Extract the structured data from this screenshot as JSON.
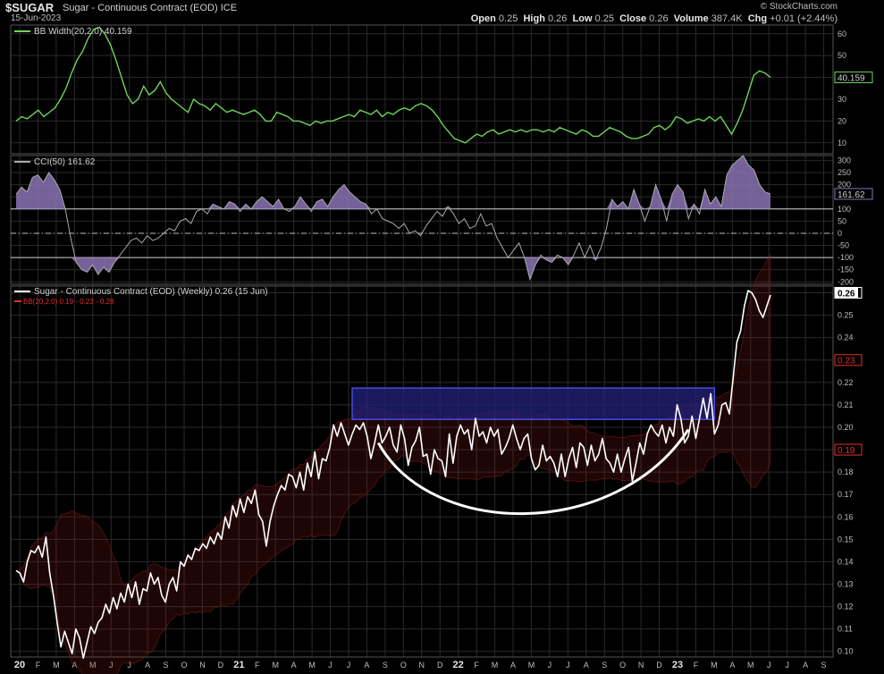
{
  "header": {
    "symbol": "$SUGAR",
    "description": "Sugar - Continuous Contract (EOD)",
    "exchange": "ICE",
    "date": "15-Jun-2023",
    "credit": "© StockCharts.com",
    "open_label": "Open",
    "open": "0.25",
    "high_label": "High",
    "high": "0.26",
    "low_label": "Low",
    "low": "0.25",
    "close_label": "Close",
    "close": "0.26",
    "volume_label": "Volume",
    "volume": "387.4K",
    "chg_label": "Chg",
    "chg": "+0.01 (+2.44%)"
  },
  "colors": {
    "background": "#000000",
    "grid": "#2a2a2a",
    "price_line": "#ffffff",
    "bb_width_line": "#6fd45a",
    "cci_line": "#aaaaaa",
    "cci_fill": "#8a73b3",
    "bb_band": "#8b1a1a",
    "rectangle_fill": "#23227a",
    "rectangle_stroke": "#4a4adf",
    "arc": "#ffffff",
    "label_red": "#e03030"
  },
  "chart_data": [
    {
      "type": "line",
      "panel": "bb-width",
      "legend": "BB Width(20,2.0) 40.159",
      "y_ticks": [
        10,
        20,
        30,
        40,
        50,
        60
      ],
      "ylim": [
        5,
        64
      ],
      "last_value_label": "40.159",
      "series": [
        {
          "name": "BB Width",
          "values": [
            20,
            22,
            21,
            23,
            25,
            22,
            24,
            26,
            30,
            35,
            42,
            48,
            52,
            58,
            62,
            63,
            60,
            55,
            48,
            40,
            32,
            28,
            30,
            36,
            32,
            34,
            38,
            33,
            30,
            28,
            26,
            24,
            30,
            28,
            27,
            25,
            28,
            26,
            24,
            25,
            24,
            23,
            24,
            25,
            23,
            20,
            20,
            24,
            23,
            22,
            20,
            20,
            19,
            18,
            20,
            19,
            20,
            20,
            21,
            22,
            23,
            22,
            25,
            24,
            23,
            25,
            22,
            24,
            23,
            25,
            26,
            25,
            27,
            28,
            27,
            25,
            22,
            18,
            15,
            12,
            11,
            10,
            12,
            14,
            13,
            15,
            16,
            14,
            15,
            16,
            15,
            16,
            15,
            16,
            16,
            15,
            16,
            15,
            17,
            16,
            15,
            14,
            16,
            15,
            13,
            13,
            15,
            17,
            16,
            15,
            13,
            12,
            12,
            13,
            14,
            17,
            18,
            16,
            18,
            22,
            21,
            19,
            20,
            21,
            20,
            22,
            20,
            22,
            18,
            14,
            19,
            25,
            33,
            41,
            43,
            42,
            40
          ]
        }
      ]
    },
    {
      "type": "line",
      "panel": "cci",
      "legend": "CCI(50) 161.62",
      "y_ticks": [
        -200,
        -150,
        -100,
        -50,
        0,
        50,
        100,
        150,
        200,
        250,
        300
      ],
      "ylim": [
        -210,
        320
      ],
      "reference_lines": [
        100,
        0,
        -100
      ],
      "last_value_label": "161.62",
      "series": [
        {
          "name": "CCI",
          "values": [
            160,
            190,
            170,
            230,
            240,
            210,
            250,
            220,
            180,
            100,
            -20,
            -120,
            -150,
            -160,
            -130,
            -170,
            -140,
            -160,
            -120,
            -90,
            -60,
            -30,
            -20,
            -40,
            -10,
            -30,
            -20,
            0,
            20,
            10,
            50,
            60,
            40,
            90,
            100,
            80,
            120,
            110,
            100,
            130,
            120,
            90,
            120,
            100,
            130,
            150,
            130,
            110,
            140,
            100,
            90,
            110,
            150,
            120,
            90,
            130,
            140,
            110,
            150,
            180,
            200,
            170,
            150,
            130,
            120,
            80,
            100,
            60,
            50,
            40,
            20,
            40,
            0,
            10,
            -10,
            30,
            60,
            90,
            70,
            110,
            80,
            40,
            60,
            20,
            30,
            80,
            30,
            40,
            -20,
            -60,
            -100,
            -70,
            -40,
            -100,
            -190,
            -130,
            -90,
            -110,
            -120,
            -90,
            -100,
            -130,
            -90,
            -40,
            -100,
            -50,
            -110,
            -60,
            20,
            140,
            110,
            130,
            100,
            180,
            120,
            50,
            110,
            200,
            140,
            50,
            160,
            200,
            170,
            60,
            120,
            80,
            180,
            120,
            150,
            110,
            240,
            280,
            300,
            320,
            280,
            260,
            200,
            170,
            162
          ]
        }
      ]
    },
    {
      "type": "line",
      "panel": "price",
      "legend": "Sugar - Continuous Contract (EOD) (Weekly) 0.26 (15 Jun)",
      "overlay_legend": "BB(20,2.0) 0.19 - 0.23 - 0.28",
      "y_ticks": [
        0.1,
        0.11,
        0.12,
        0.13,
        0.14,
        0.15,
        0.16,
        0.17,
        0.18,
        0.19,
        0.2,
        0.21,
        0.22,
        0.23,
        0.24,
        0.25,
        0.26
      ],
      "ylim": [
        0.0975,
        0.263
      ],
      "value_labels": {
        "last": "0.26",
        "upper_band": "0.23",
        "lower_band": "0.19"
      },
      "x_tick_labels": [
        "20",
        "F",
        "M",
        "A",
        "M",
        "J",
        "J",
        "A",
        "S",
        "O",
        "N",
        "D",
        "21",
        "F",
        "M",
        "A",
        "M",
        "J",
        "J",
        "A",
        "S",
        "O",
        "N",
        "D",
        "22",
        "F",
        "M",
        "A",
        "M",
        "J",
        "J",
        "A",
        "S",
        "O",
        "N",
        "D",
        "23",
        "F",
        "M",
        "A",
        "M",
        "J",
        "J",
        "A",
        "S"
      ],
      "series": [
        {
          "name": "Sugar",
          "values": [
            0.136,
            0.135,
            0.131,
            0.14,
            0.145,
            0.144,
            0.147,
            0.142,
            0.151,
            0.135,
            0.125,
            0.113,
            0.102,
            0.109,
            0.104,
            0.099,
            0.11,
            0.106,
            0.097,
            0.104,
            0.111,
            0.108,
            0.113,
            0.115,
            0.121,
            0.117,
            0.124,
            0.119,
            0.126,
            0.122,
            0.13,
            0.124,
            0.131,
            0.121,
            0.128,
            0.127,
            0.135,
            0.13,
            0.133,
            0.125,
            0.122,
            0.13,
            0.133,
            0.127,
            0.14,
            0.138,
            0.143,
            0.141,
            0.146,
            0.145,
            0.148,
            0.146,
            0.151,
            0.148,
            0.153,
            0.15,
            0.16,
            0.155,
            0.165,
            0.16,
            0.168,
            0.162,
            0.169,
            0.166,
            0.172,
            0.161,
            0.158,
            0.147,
            0.158,
            0.165,
            0.17,
            0.174,
            0.172,
            0.179,
            0.178,
            0.173,
            0.18,
            0.172,
            0.184,
            0.178,
            0.189,
            0.177,
            0.186,
            0.185,
            0.191,
            0.201,
            0.196,
            0.202,
            0.197,
            0.192,
            0.197,
            0.201,
            0.199,
            0.202,
            0.196,
            0.186,
            0.193,
            0.201,
            0.193,
            0.196,
            0.2,
            0.192,
            0.189,
            0.201,
            0.195,
            0.183,
            0.191,
            0.194,
            0.2,
            0.187,
            0.188,
            0.179,
            0.19,
            0.186,
            0.185,
            0.178,
            0.197,
            0.184,
            0.196,
            0.201,
            0.197,
            0.199,
            0.19,
            0.204,
            0.196,
            0.198,
            0.193,
            0.2,
            0.196,
            0.199,
            0.188,
            0.191,
            0.195,
            0.201,
            0.195,
            0.19,
            0.195,
            0.197,
            0.186,
            0.181,
            0.183,
            0.192,
            0.185,
            0.187,
            0.184,
            0.178,
            0.188,
            0.178,
            0.186,
            0.191,
            0.182,
            0.193,
            0.191,
            0.183,
            0.192,
            0.185,
            0.188,
            0.195,
            0.186,
            0.184,
            0.18,
            0.188,
            0.18,
            0.186,
            0.191,
            0.176,
            0.184,
            0.193,
            0.188,
            0.197,
            0.201,
            0.198,
            0.196,
            0.201,
            0.193,
            0.2,
            0.196,
            0.21,
            0.204,
            0.193,
            0.196,
            0.205,
            0.195,
            0.204,
            0.213,
            0.204,
            0.215,
            0.197,
            0.201,
            0.21,
            0.211,
            0.206,
            0.222,
            0.238,
            0.243,
            0.254,
            0.261,
            0.26,
            0.257,
            0.252,
            0.249,
            0.254,
            0.259
          ]
        }
      ]
    }
  ],
  "annotations": {
    "rectangle": "consolidation box",
    "arc": "rounding bottom"
  }
}
